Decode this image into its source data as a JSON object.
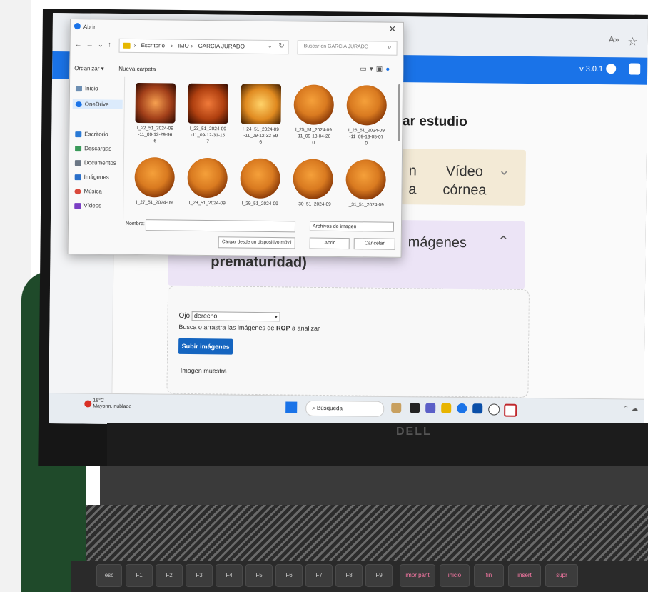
{
  "browser": {
    "read_aloud_icon": "read-aloud-icon",
    "favorite_icon": "star-icon"
  },
  "app": {
    "version": "v 3.0.1",
    "page_title": "gar estudio",
    "video_card": {
      "frag_left_1": "n",
      "frag_left_2": "a",
      "title_1": "Vídeo",
      "title_2": "córnea"
    },
    "rop_card": {
      "title_1": "mágenes",
      "title_2": "prematuridad)"
    },
    "upload": {
      "eye_label": "Ojo",
      "eye_value": "derecho",
      "hint_prefix": "Busca o arrastra las imágenes de ",
      "hint_bold": "ROP",
      "hint_suffix": " a analizar",
      "button_label": "Subir imágenes",
      "sample_label": "Imagen muestra"
    }
  },
  "dialog": {
    "title": "Abrir",
    "path": [
      "Escritorio",
      "IMO",
      "GARCIA JURADO"
    ],
    "search_placeholder": "Buscar en GARCIA JURADO",
    "organize": "Organizar ▾",
    "new_folder": "Nueva carpeta",
    "nav": [
      {
        "label": "Inicio",
        "icon": "home-icon"
      },
      {
        "label": "OneDrive",
        "icon": "cloud-icon"
      },
      {
        "label": "Escritorio",
        "icon": "desktop-icon"
      },
      {
        "label": "Descargas",
        "icon": "download-icon"
      },
      {
        "label": "Documentos",
        "icon": "documents-icon"
      },
      {
        "label": "Imágenes",
        "icon": "pictures-icon"
      },
      {
        "label": "Música",
        "icon": "music-icon"
      },
      {
        "label": "Vídeos",
        "icon": "videos-icon"
      }
    ],
    "files": [
      {
        "name": "I_22_51_2024-09\n-11_09-12-29-96\n6"
      },
      {
        "name": "I_23_51_2024-09\n-11_09-12-31-15\n7"
      },
      {
        "name": "I_24_51_2024-09\n-11_09-12-32-59\n6"
      },
      {
        "name": "I_25_51_2024-09\n-11_09-13-04-20\n0"
      },
      {
        "name": "I_26_51_2024-09\n-11_09-13-05-07\n0"
      },
      {
        "name": "I_27_51_2024-09"
      },
      {
        "name": "I_28_51_2024-09"
      },
      {
        "name": "I_29_51_2024-09"
      },
      {
        "name": "I_30_51_2024-09"
      },
      {
        "name": "I_31_51_2024-09"
      }
    ],
    "name_label": "Nombre:",
    "file_type": "Archivos de imagen",
    "btn_device": "Cargar desde un dispositivo móvil",
    "btn_open": "Abrir",
    "btn_cancel": "Cancelar"
  },
  "taskbar": {
    "weather_temp": "18°C",
    "weather_desc": "Mayorm. nublado",
    "search": "Búsqueda"
  },
  "laptop": {
    "brand": "DELL",
    "keys": [
      "esc",
      "F1",
      "F2",
      "F3",
      "F4",
      "F5",
      "F6",
      "F7",
      "F8",
      "F9",
      "impr pant",
      "inicio",
      "fin",
      "insert",
      "supr"
    ]
  }
}
